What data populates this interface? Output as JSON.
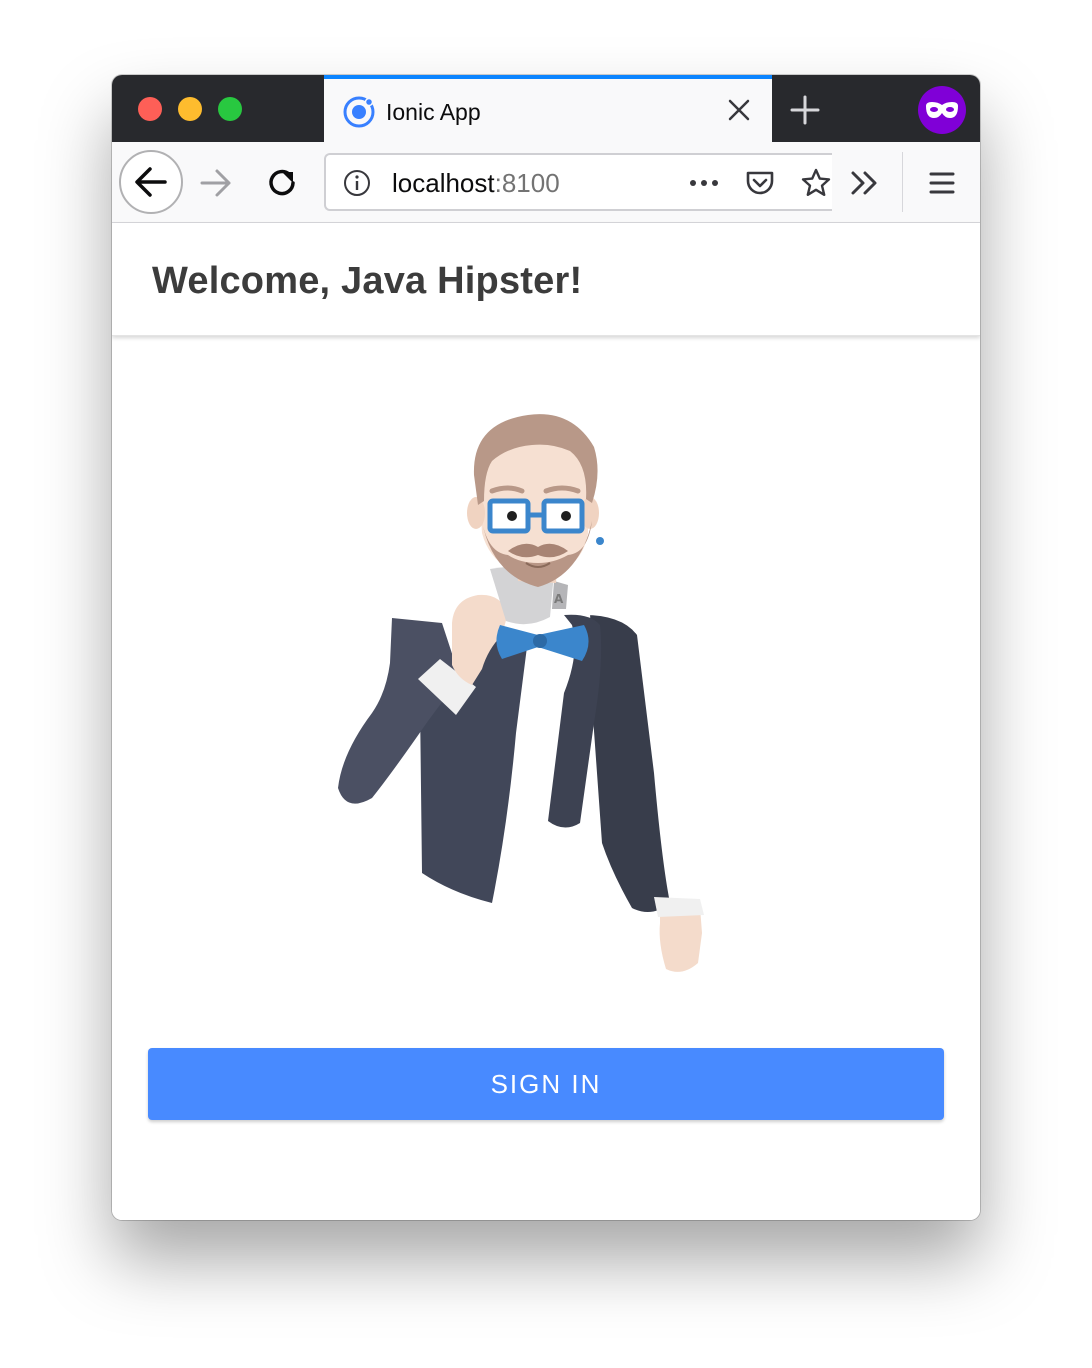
{
  "browser": {
    "tab": {
      "title": "Ionic App",
      "icon": "ionic-logo-icon"
    },
    "new_tab_icon": "plus-icon",
    "private_browsing_icon": "mask-icon",
    "toolbar": {
      "back_icon": "arrow-left-icon",
      "forward_icon": "arrow-right-icon",
      "reload_icon": "reload-icon",
      "url_host": "localhost",
      "url_port": ":8100",
      "site_info_icon": "info-icon",
      "page_actions_icon": "more-dots-icon",
      "pocket_icon": "pocket-icon",
      "bookmark_icon": "star-icon",
      "overflow_icon": "chevron-double-right-icon",
      "menu_icon": "hamburger-menu-icon"
    },
    "colors": {
      "tab_accent": "#0a84ff",
      "tabstrip_bg": "#28292d",
      "private_badge": "#8000d7"
    }
  },
  "page": {
    "header": {
      "title": "Welcome, Java Hipster!"
    },
    "illustration": "jhipster-mascot",
    "signin_button": {
      "label": "SIGN IN",
      "color": "#488aff"
    }
  }
}
